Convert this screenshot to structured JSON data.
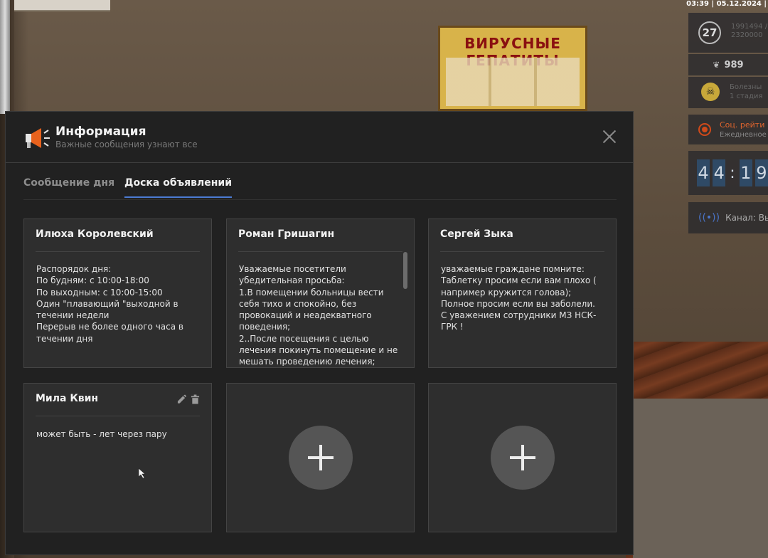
{
  "scene": {
    "poster_title": "ВИРУСНЫЕ ГЕПАТИТЫ"
  },
  "hud": {
    "datetime": "03:39 | 05.12.2024 |",
    "level": "27",
    "xp_line1": "1991494 /",
    "xp_line2": "2320000",
    "money": "989",
    "disease_line1": "Болезны",
    "disease_line2": "1 стадия",
    "social_title": "Соц. рейти",
    "social_sub": "Ежедневное",
    "timer_digits": [
      "4",
      "4",
      "1",
      "9"
    ],
    "timer_sep": ":",
    "channel": "Канал: Вык"
  },
  "modal": {
    "title": "Информация",
    "subtitle": "Важные сообщения узнают все",
    "tabs": [
      {
        "label": "Сообщение дня",
        "active": false
      },
      {
        "label": "Доска объявлений",
        "active": true
      }
    ],
    "cards": [
      {
        "name": "Илюха Королевский",
        "text": "Распорядок дня:\nПо будням: с 10:00-18:00\nПо выходным: с 10:00-15:00\nОдин \"плавающий \"выходной в течении недели\nПерерыв не более одного часа в течении дня"
      },
      {
        "name": "Роман Гришагин",
        "text": "Уважаемые посетители убедительная просьба:\n1.В помещении больницы вести себя тихо и спокойно, без провокаций и неадекватного поведения;\n2..После посещения с целью лечения покинуть помещение и не мешать проведению лечения;"
      },
      {
        "name": "Сергей Зыка",
        "text": "уважаемые граждане помните:\nТаблетку просим если вам плохо ( например кружится голова);\nПолное просим если вы заболели.\nС уважением сотрудники МЗ НСК-ГРК !"
      },
      {
        "name": "Мила Квин",
        "text": "может быть - лет через пару"
      }
    ]
  },
  "colors": {
    "accent": "#4c7bd3",
    "modal_bg": "#212121",
    "card_bg": "#2e2e2e",
    "social_accent": "#e0652e"
  },
  "icons": {
    "header": "megaphone-icon",
    "close": "close-icon",
    "edit": "pencil-icon",
    "delete": "trash-icon",
    "add": "plus-icon"
  }
}
